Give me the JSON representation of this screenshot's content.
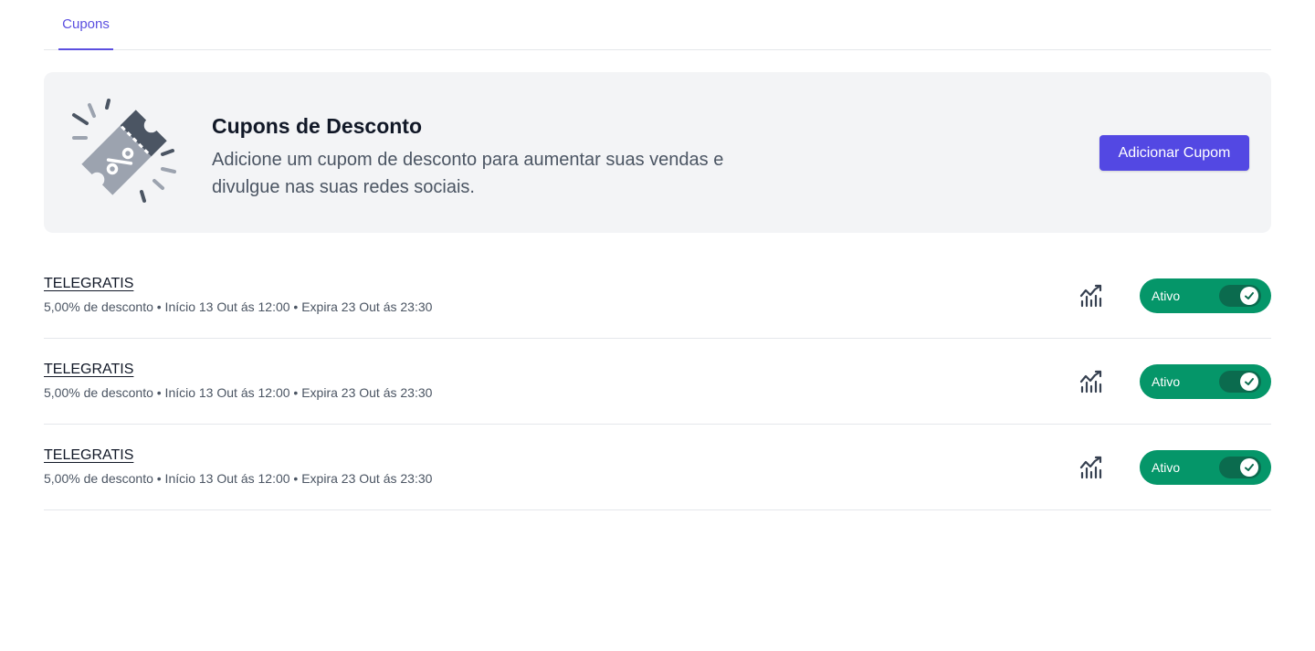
{
  "tabs": [
    {
      "label": "Cupons",
      "active": true
    }
  ],
  "banner": {
    "icon": "discount-ticket-icon",
    "title": "Cupons de Desconto",
    "description": "Adicione um cupom de desconto para aumentar suas vendas e divulgue nas suas redes sociais.",
    "button_label": "Adicionar Cupom"
  },
  "coupons": [
    {
      "code": "TELEGRATIS",
      "details": "5,00% de desconto • Início 13 Out ás 12:00 • Expira 23 Out ás 23:30",
      "stats_icon": "chart-trend-icon",
      "status_label": "Ativo",
      "enabled": true
    },
    {
      "code": "TELEGRATIS",
      "details": "5,00% de desconto • Início 13 Out ás 12:00 • Expira 23 Out ás 23:30",
      "stats_icon": "chart-trend-icon",
      "status_label": "Ativo",
      "enabled": true
    },
    {
      "code": "TELEGRATIS",
      "details": "5,00% de desconto • Início 13 Out ás 12:00 • Expira 23 Out ás 23:30",
      "stats_icon": "chart-trend-icon",
      "status_label": "Ativo",
      "enabled": true
    }
  ],
  "colors": {
    "accent": "#5348e3",
    "active_green": "#059669",
    "banner_bg": "#f3f4f6"
  }
}
